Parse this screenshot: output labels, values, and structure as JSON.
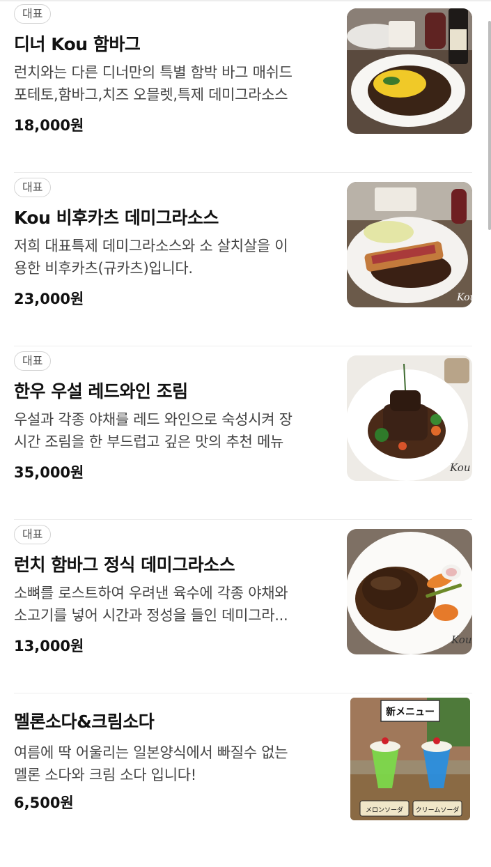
{
  "menu": [
    {
      "badge": "대표",
      "title": "디너 Kou 함바그",
      "desc1": "런치와는 다른 디너만의 특별 함박 바그 매쉬드",
      "desc2": "포테토,함바그,치즈 오믈렛,특제 데미그라소스",
      "price": "18,000원",
      "image": "hamburg-steak-dinner-photo"
    },
    {
      "badge": "대표",
      "title": "Kou 비후카츠 데미그라소스",
      "desc1": "저희 대표특제 데미그라소스와 소 살치살을 이",
      "desc2": "용한 비후카츠(규카츠)입니다.",
      "price": "23,000원",
      "image": "beef-katsu-photo",
      "watermark": "Kou"
    },
    {
      "badge": "대표",
      "title": "한우 우설 레드와인 조림",
      "desc1": "우설과 각종 야채를 레드 와인으로 숙성시켜 장",
      "desc2": "시간 조림을 한 부드럽고 깊은 맛의 추천 메뉴",
      "price": "35,000원",
      "image": "beef-tongue-stew-photo",
      "watermark": "Kou"
    },
    {
      "badge": "대표",
      "title": "런치 함바그 정식 데미그라소스",
      "desc1": "소뼈를 로스트하여 우려낸 육수에 각종 야채와",
      "desc2": "소고기를 넣어 시간과 정성을 들인 데미그라...",
      "price": "13,000원",
      "image": "lunch-hamburg-photo",
      "watermark": "Kou"
    },
    {
      "title": "멜론소다&크림소다",
      "desc1": "여름에 딱 어울리는 일본양식에서 빠질수 없는",
      "desc2": "멜론 소다와 크림 소다 입니다!",
      "price": "6,500원",
      "image": "melon-cream-soda-photo",
      "sign": "新メニュー",
      "label1": "メロンソーダ",
      "label2": "クリームソーダ"
    }
  ]
}
